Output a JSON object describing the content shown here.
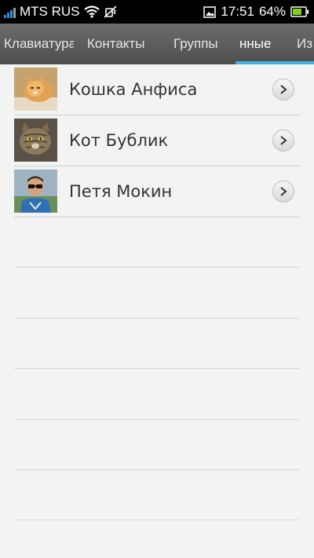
{
  "status_bar": {
    "carrier": "MTS RUS",
    "time": "17:51",
    "battery_percent": "64%"
  },
  "tabs": [
    {
      "label": "Клавиатура"
    },
    {
      "label": "Контакты"
    },
    {
      "label": "Группы"
    },
    {
      "label": "нные"
    },
    {
      "label": "Из"
    }
  ],
  "contacts": [
    {
      "name": "Кошка Анфиса"
    },
    {
      "name": "Кот Бублик"
    },
    {
      "name": "Петя Мокин"
    }
  ],
  "colors": {
    "tab_indicator": "#3fb4e4",
    "signal": "#2f8fe0",
    "battery": "#7ed321"
  }
}
